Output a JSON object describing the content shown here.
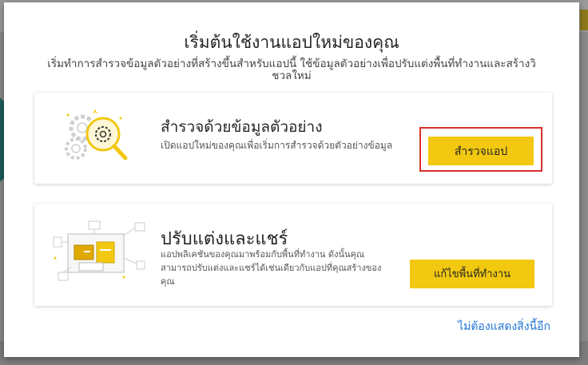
{
  "modal": {
    "title": "เริ่มต้นใช้งานแอปใหม่ของคุณ",
    "subtitle": "เริ่มทำการสำรวจข้อมูลตัวอย่างที่สร้างขึ้นสำหรับแอปนี้ ใช้ข้อมูลตัวอย่างเพื่อปรับแต่งพื้นที่ทำงานและสร้างวิชวลใหม่"
  },
  "cards": [
    {
      "title": "สำรวจด้วยข้อมูลตัวอย่าง",
      "description": "เปิดแอปใหม่ของคุณเพื่อเริ่มการสำรวจด้วยตัวอย่างข้อมูล",
      "button_label": "สำรวจแอป",
      "icon": "magnifier-gears-icon"
    },
    {
      "title": "ปรับแต่งและแชร์",
      "description": "แอปพลิเคชันของคุณมาพร้อมกับพื้นที่ทำงาน ดังนั้นคุณสามารถปรับแต่งและแชร์ได้เช่นเดียวกับแอปที่คุณสร้างของคุณ",
      "button_label": "แก้ไขพื้นที่ทำงาน",
      "icon": "dashboard-illustration-icon"
    }
  ],
  "footer": {
    "dismiss_link": "ไม่ต้องแสดงสิ่งนี้อีก"
  },
  "colors": {
    "accent": "#f2c811",
    "highlight": "#d9302c",
    "link": "#1f74d6"
  }
}
